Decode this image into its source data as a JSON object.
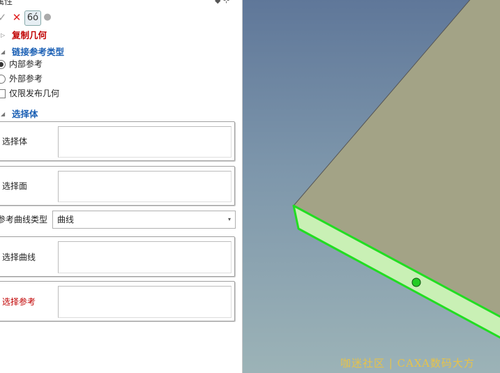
{
  "panel": {
    "title": "属性",
    "pin_glyph": "◆ ⊹"
  },
  "toolbar": {
    "ok_glyph": "✓",
    "cancel_glyph": "✕",
    "preview_glyph": "6ó",
    "dot_glyph": "●"
  },
  "sections": {
    "copy_geometry": "复制几何",
    "link_type": "链接参考类型",
    "select_body": "选择体"
  },
  "options": {
    "internal_ref": "内部参考",
    "external_ref": "外部参考",
    "publish_only": "仅限发布几何"
  },
  "fields": {
    "select_body": "选择体",
    "select_face": "选择面",
    "curve_type_label": "参考曲线类型",
    "curve_type_value": "曲线",
    "select_curve": "选择曲线",
    "select_reference": "选择参考"
  },
  "icons": {
    "section_expanded": "◢",
    "section_collapsed": "▷",
    "dropdown": "▾"
  },
  "colors": {
    "section_red": "#c00000",
    "section_blue": "#1a5fb4",
    "selected_edge": "#22dd22",
    "watermark": "#e6c24a"
  },
  "watermark": "咖迷社区 | CAXA数码大方"
}
